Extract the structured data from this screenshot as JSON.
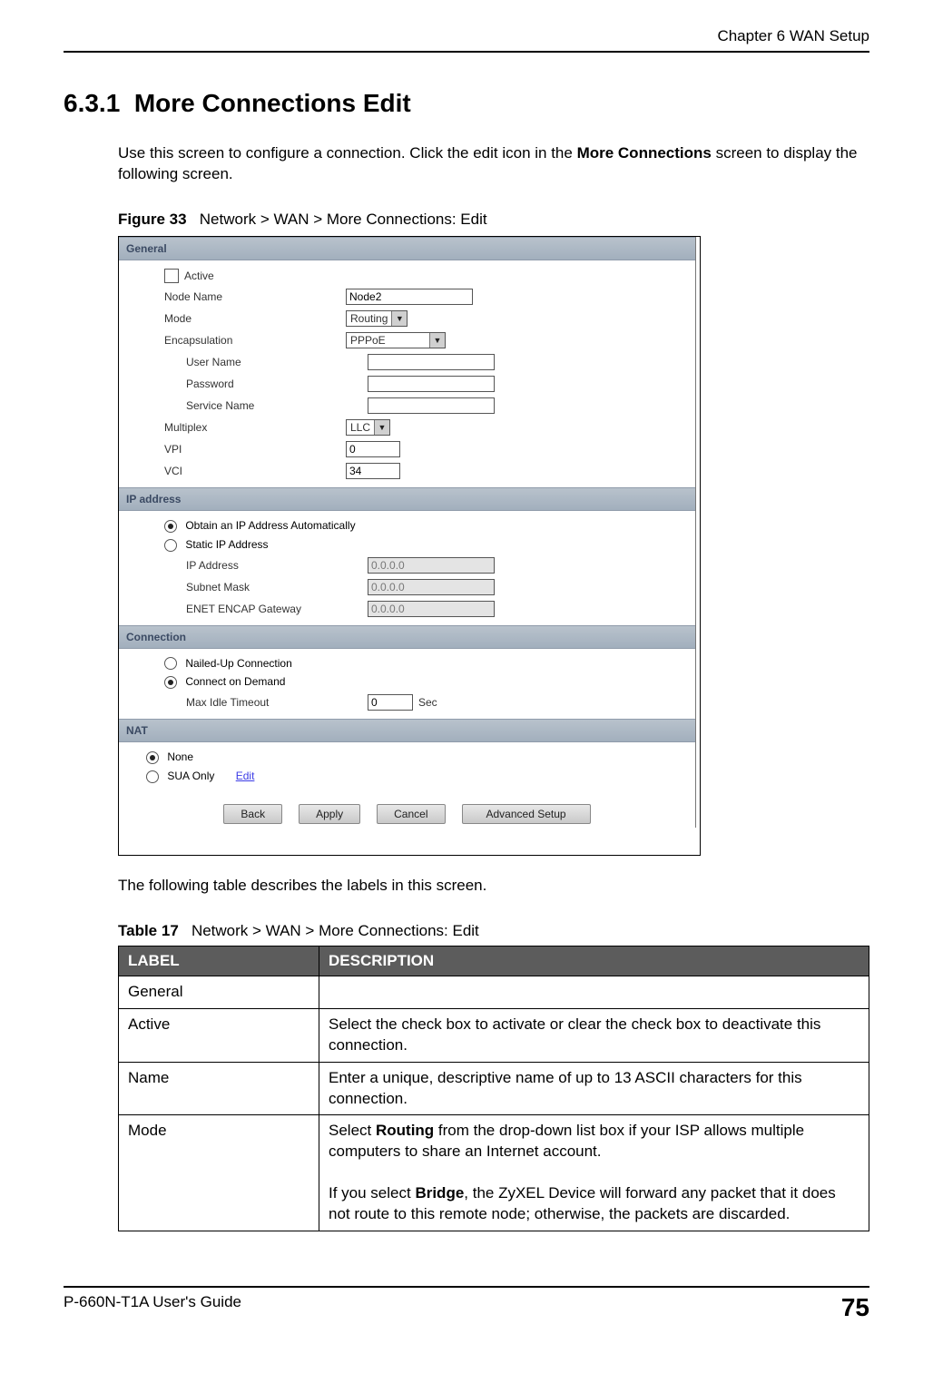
{
  "header": {
    "chapter": "Chapter 6 WAN Setup"
  },
  "section": {
    "number": "6.3.1",
    "title": "More Connections Edit",
    "intro_pre": "Use this screen to configure a connection. Click the edit icon in the ",
    "intro_bold": "More Connections",
    "intro_post": " screen to display the following screen."
  },
  "figure": {
    "label": "Figure 33",
    "caption": "Network > WAN > More Connections: Edit"
  },
  "screenshot": {
    "sections": {
      "general": "General",
      "ip": "IP address",
      "conn": "Connection",
      "nat": "NAT"
    },
    "general": {
      "active_label": "Active",
      "node_name_label": "Node Name",
      "node_name_value": "Node2",
      "mode_label": "Mode",
      "mode_value": "Routing",
      "encap_label": "Encapsulation",
      "encap_value": "PPPoE",
      "user_label": "User Name",
      "pwd_label": "Password",
      "svc_label": "Service Name",
      "mux_label": "Multiplex",
      "mux_value": "LLC",
      "vpi_label": "VPI",
      "vpi_value": "0",
      "vci_label": "VCI",
      "vci_value": "34"
    },
    "ip": {
      "auto_label": "Obtain an IP Address Automatically",
      "static_label": "Static IP Address",
      "ipaddr_label": "IP Address",
      "ipaddr_value": "0.0.0.0",
      "subnet_label": "Subnet Mask",
      "subnet_value": "0.0.0.0",
      "gw_label": "ENET ENCAP Gateway",
      "gw_value": "0.0.0.0"
    },
    "conn": {
      "nailed_label": "Nailed-Up Connection",
      "demand_label": "Connect on Demand",
      "idle_label": "Max Idle Timeout",
      "idle_value": "0",
      "idle_suffix": "Sec"
    },
    "nat": {
      "none_label": "None",
      "sua_label": "SUA Only",
      "edit_link": "Edit"
    },
    "buttons": {
      "back": "Back",
      "apply": "Apply",
      "cancel": "Cancel",
      "advanced": "Advanced Setup"
    }
  },
  "after_figure": "The following table describes the labels in this screen.",
  "table": {
    "label": "Table 17",
    "caption": "Network > WAN > More Connections: Edit",
    "headers": {
      "label": "LABEL",
      "desc": "DESCRIPTION"
    },
    "rows": {
      "r0": {
        "label": "General",
        "desc": ""
      },
      "r1": {
        "label": "Active",
        "desc": "Select the check box to activate or clear the check box to deactivate this connection."
      },
      "r2": {
        "label": "Name",
        "desc": "Enter a unique, descriptive name of up to 13 ASCII characters for this connection."
      },
      "r3": {
        "label": "Mode",
        "desc_p1_pre": "Select ",
        "desc_p1_b": "Routing",
        "desc_p1_post": " from the drop-down list box if your ISP allows multiple computers to share an Internet account.",
        "desc_p2_pre": "If you select ",
        "desc_p2_b": "Bridge",
        "desc_p2_post": ", the ZyXEL Device will forward any packet that it does not route to this remote node; otherwise, the packets are discarded."
      }
    }
  },
  "footer": {
    "guide": "P-660N-T1A User's Guide",
    "page": "75"
  }
}
